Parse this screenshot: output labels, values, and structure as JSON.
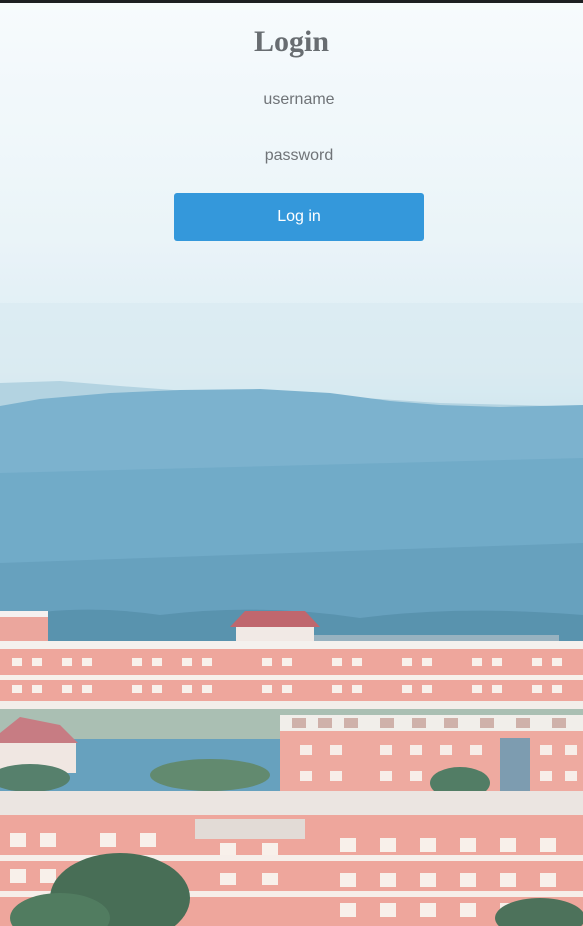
{
  "login": {
    "title": "Login",
    "username_placeholder": "username",
    "password_placeholder": "password",
    "submit_label": "Log in"
  },
  "colors": {
    "button": "#3498db",
    "title": "#686d71",
    "placeholder": "#6f7377"
  }
}
